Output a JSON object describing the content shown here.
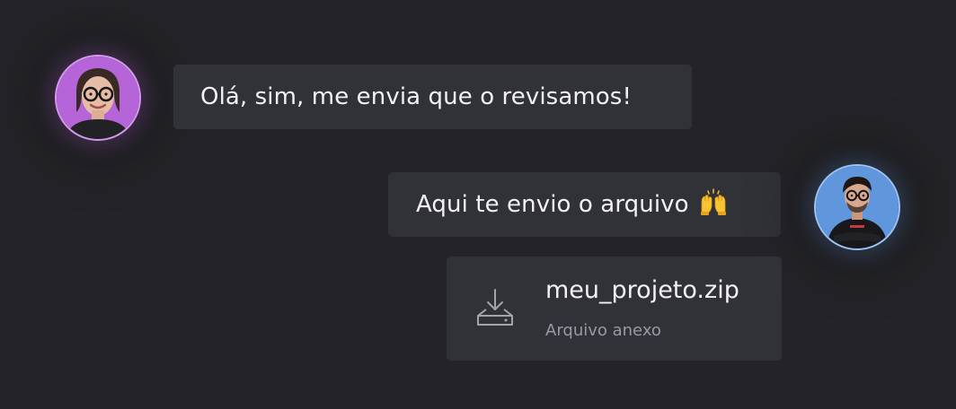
{
  "chat": {
    "messages": [
      {
        "sender": "left-user",
        "text": "Olá, sim, me envia que o revisamos!"
      },
      {
        "sender": "right-user",
        "text": "Aqui te envio o arquivo",
        "emoji": "raising-hands"
      }
    ],
    "attachment": {
      "filename": "meu_projeto.zip",
      "subtitle": "Arquivo anexo",
      "icon": "download-icon"
    }
  },
  "colors": {
    "background": "#242428",
    "bubble": "#313138",
    "left_avatar_ring": "#d59af0",
    "right_avatar_ring": "#9cc2f6",
    "left_avatar_bg": "#b565d8",
    "right_avatar_bg": "#5f96dc"
  }
}
